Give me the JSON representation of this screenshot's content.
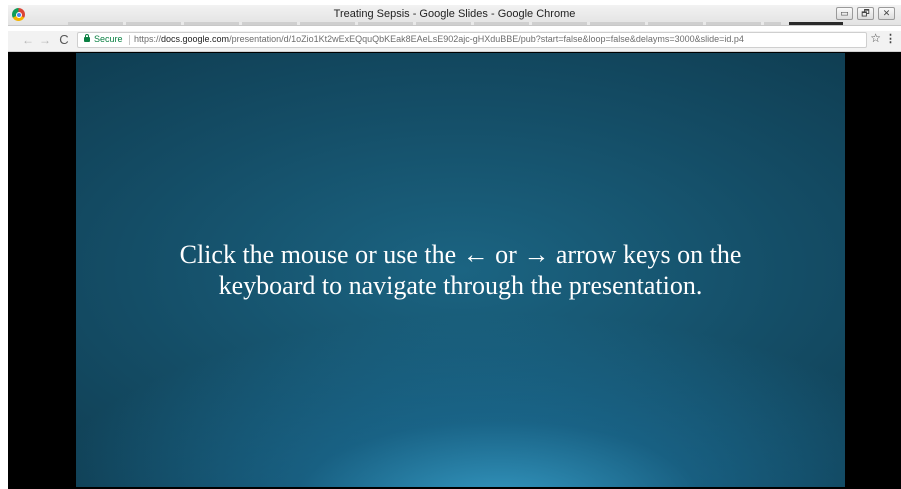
{
  "window": {
    "title": "Treating Sepsis - Google Slides - Google Chrome",
    "controls": {
      "minimize": "▭",
      "maximize": "🗗",
      "close": "✕"
    }
  },
  "toolbar": {
    "back_icon": "←",
    "forward_icon": "→",
    "reload_icon": "C",
    "secure_label": "Secure",
    "url_scheme": "https://",
    "url_host": "docs.google.com",
    "url_path": "/presentation/d/1oZio1Kt2wExEQquQbKEak8EAeLsE902ajc-gHXduBBE/pub?start=false&loop=false&delayms=3000&slide=id.p4",
    "star_icon": "☆",
    "menu_icon": "⋮"
  },
  "slide": {
    "line1": "Click the mouse or use the ← or → arrow keys on the",
    "line2": "keyboard to navigate through the presentation."
  },
  "colors": {
    "slide_base": "#144d66",
    "slide_glow": "#3caad7",
    "secure_green": "#0b8043",
    "letterbox": "#000000"
  },
  "icons": [
    "chrome-logo-icon",
    "back-arrow-icon",
    "forward-arrow-icon",
    "reload-icon",
    "lock-icon",
    "star-icon",
    "menu-icon"
  ]
}
